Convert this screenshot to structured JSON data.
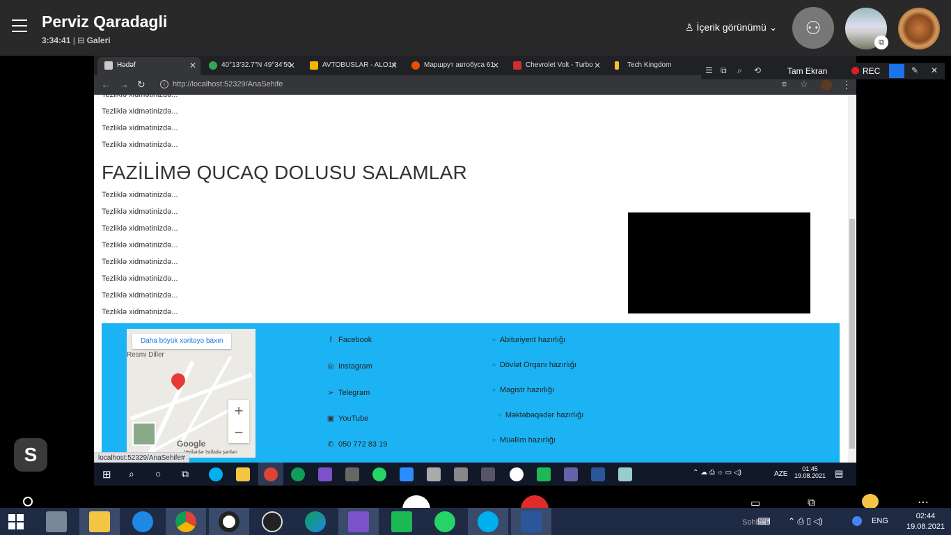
{
  "call": {
    "caller_name": "Perviz Qaradagli",
    "duration": "3:34:41",
    "separator": "|",
    "gallery_label": "Galeri",
    "content_view_label": "İçerik görünümü",
    "chevron": "⌄"
  },
  "browser": {
    "tabs": [
      {
        "label": "Hədəf",
        "active": true
      },
      {
        "label": "40°13'32.7\"N 49°34'50",
        "active": false
      },
      {
        "label": "AVTOBUSLAR - ALO14",
        "active": false
      },
      {
        "label": "Маршрут автобуса 61",
        "active": false
      },
      {
        "label": "Chevrolet Volt - Turbo",
        "active": false
      },
      {
        "label": "Tech Kingdom",
        "active": false
      }
    ],
    "url_host": "http://localhost",
    "url_path": ":52329/AnaSehife",
    "status_url": "localhost:52329/AnaSehife#"
  },
  "screen_toolbar": {
    "full_screen_label": "Tam Ekran",
    "rec_label": "REC"
  },
  "page": {
    "line_text": "Tezliklə xidmətinizdə...",
    "headline": "FAZİLİMƏ QUCAQ DOLUSU SALAMLAR",
    "map": {
      "bigger_map_label": "Daha böyük xəritəyə baxın",
      "place_label": "Resmi Diller",
      "google_label": "Google",
      "terms_label": "Verilənlər   İstifadə şərtləri",
      "zoom_in": "+",
      "zoom_out": "−"
    },
    "social": [
      "Facebook",
      "Instagram",
      "Telegram",
      "YouTube",
      "050 772 83 19"
    ],
    "services": [
      "Abituriyent hazırlığı",
      "Dövlət Orqanı hazırlığı",
      "Magistr hazırlığı",
      "Məktəbəqədər hazırlığı",
      "Müəllim hazırlığı"
    ]
  },
  "remote_taskbar": {
    "lang": "AZE",
    "time": "01:45",
    "date": "19.08.2021"
  },
  "taskbar": {
    "sohbet_label": "Sohbet",
    "lang": "ENG",
    "time": "02:44",
    "date": "19.08.2021"
  }
}
